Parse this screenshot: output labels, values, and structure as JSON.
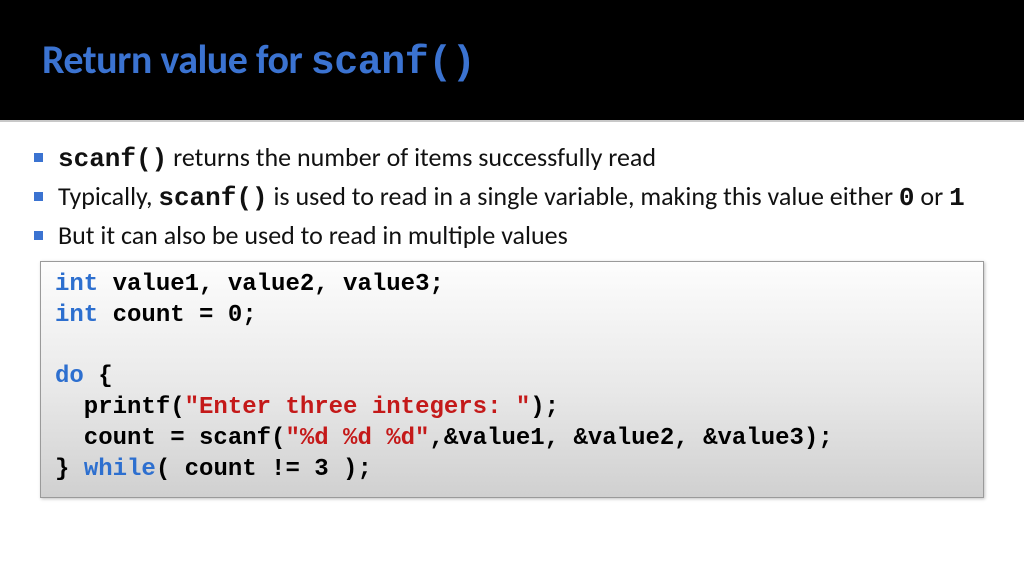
{
  "header": {
    "title_prefix": "Return value for ",
    "title_code": "scanf()"
  },
  "bullets": {
    "b1_code": "scanf()",
    "b1_text": " returns the number of items successfully read",
    "b2_a": "Typically, ",
    "b2_code": "scanf()",
    "b2_b": " is used to read in a single variable, making this value either ",
    "b2_zero": "0",
    "b2_or": " or ",
    "b2_one": "1",
    "b3": "But it can also be used to read in multiple values"
  },
  "code": {
    "int1": "int",
    "decl1": " value1, value2, value3;",
    "int2": "int",
    "decl2": " count = 0;",
    "blank": "",
    "do": "do",
    "brace_open": " {",
    "printf_a": "  printf(",
    "printf_str": "\"Enter three integers: \"",
    "printf_b": ");",
    "scanf_a": "  count = scanf(",
    "scanf_str": "\"%d %d %d\"",
    "scanf_b": ",&value1, &value2, &value3);",
    "brace_close": "} ",
    "while": "while",
    "while_cond": "( count != 3 );"
  }
}
